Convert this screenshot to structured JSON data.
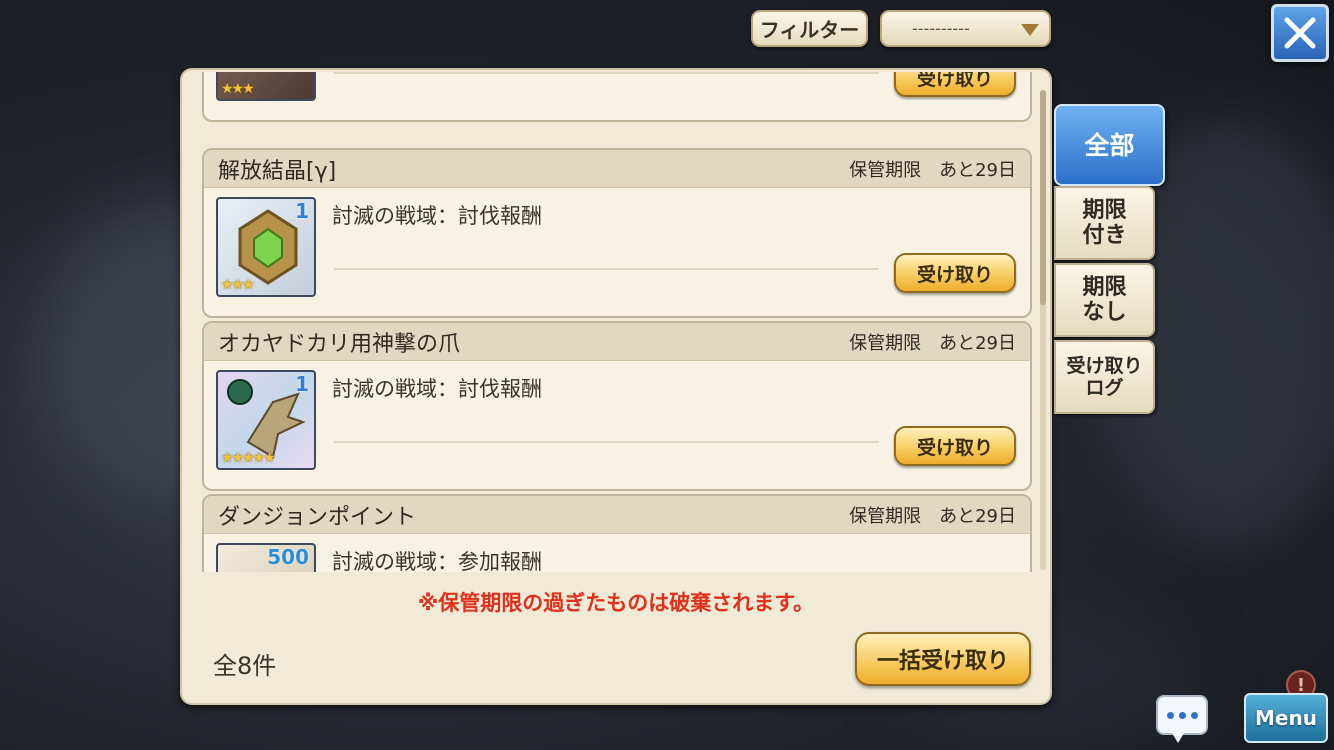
{
  "filter": {
    "label": "フィルター",
    "selected": "----------"
  },
  "tabs": [
    {
      "label": "全部",
      "active": true
    },
    {
      "label": "期限\n付き",
      "active": false
    },
    {
      "label": "期限\nなし",
      "active": false
    },
    {
      "label": "受け取り\nログ",
      "active": false
    }
  ],
  "items": [
    {
      "title": "",
      "expiry_label": "",
      "expiry_value": "",
      "source": "",
      "count": "",
      "stars": "★★★",
      "button": "受け取り"
    },
    {
      "title": "解放結晶[γ]",
      "expiry_label": "保管期限",
      "expiry_value": "あと29日",
      "source": "討滅の戦域：討伐報酬",
      "count": "1",
      "stars": "★★★",
      "button": "受け取り"
    },
    {
      "title": "オカヤドカリ用神撃の爪",
      "expiry_label": "保管期限",
      "expiry_value": "あと29日",
      "source": "討滅の戦域：討伐報酬",
      "count": "1",
      "stars": "★★★★★",
      "button": "受け取り"
    },
    {
      "title": "ダンジョンポイント",
      "expiry_label": "保管期限",
      "expiry_value": "あと29日",
      "source": "討滅の戦域：参加報酬",
      "count": "500",
      "stars": "",
      "button": ""
    }
  ],
  "notice": "※保管期限の過ぎたものは破棄されます。",
  "total": "全8件",
  "bulk_button": "一括受け取り",
  "menu_button": "Menu",
  "alert_badge": "!",
  "colors": {
    "accent_blue": "#2c6fc9",
    "notice_red": "#e0311d",
    "gold_button": "#f7c95a",
    "panel_bg": "#f1ead7"
  }
}
